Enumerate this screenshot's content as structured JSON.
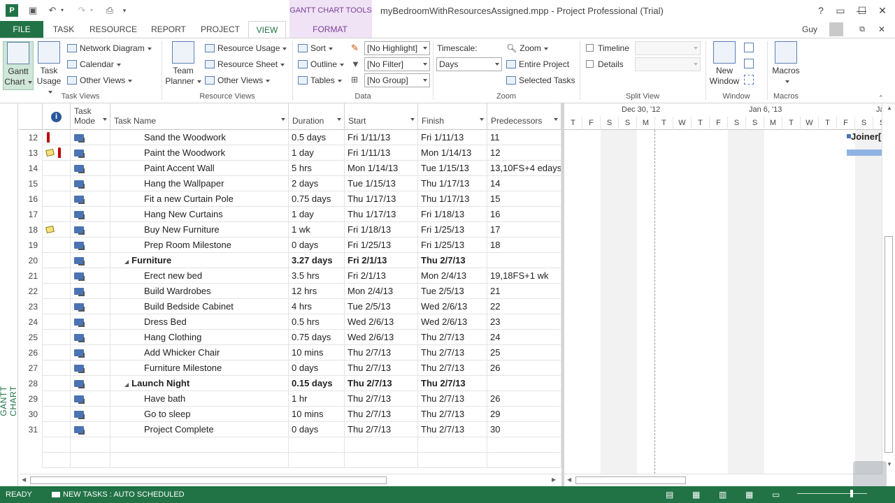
{
  "window": {
    "contextual_tab_group": "GANTT CHART TOOLS",
    "doc_title": "myBedroomWithResourcesAssigned.mpp - Project Professional (Trial)",
    "help": "?",
    "user": "Guy"
  },
  "tabs": [
    "FILE",
    "TASK",
    "RESOURCE",
    "REPORT",
    "PROJECT",
    "VIEW",
    "FORMAT"
  ],
  "ribbon": {
    "task_views": {
      "label": "Task Views",
      "gantt_chart": "Gantt Chart",
      "task_usage": "Task Usage",
      "network_diagram": "Network Diagram",
      "calendar": "Calendar",
      "other_views": "Other Views"
    },
    "resource_views": {
      "label": "Resource Views",
      "team_planner": "Team Planner",
      "resource_usage": "Resource Usage",
      "resource_sheet": "Resource Sheet",
      "other_views": "Other Views"
    },
    "data": {
      "label": "Data",
      "sort": "Sort",
      "outline": "Outline",
      "tables": "Tables",
      "highlight": "[No Highlight]",
      "filter": "[No Filter]",
      "group": "[No Group]"
    },
    "zoom": {
      "label": "Zoom",
      "timescale_label": "Timescale:",
      "timescale_value": "Days",
      "zoom": "Zoom",
      "entire_project": "Entire Project",
      "selected_tasks": "Selected Tasks"
    },
    "split_view": {
      "label": "Split View",
      "timeline": "Timeline",
      "details": "Details"
    },
    "window": {
      "label": "Window",
      "new_window": "New Window"
    },
    "macros": {
      "label": "Macros",
      "macros": "Macros"
    }
  },
  "view_side_label": "GANTT CHART",
  "columns": {
    "task_mode": "Task Mode",
    "task_name": "Task Name",
    "duration": "Duration",
    "start": "Start",
    "finish": "Finish",
    "predecessors": "Predecessors"
  },
  "rows": [
    {
      "id": "12",
      "name": "Sand the Woodwork",
      "duration": "0.5 days",
      "start": "Fri 1/11/13",
      "finish": "Fri 1/11/13",
      "pred": "11",
      "level": 2,
      "summary": false,
      "indicator": "person"
    },
    {
      "id": "13",
      "name": "Paint the Woodwork",
      "duration": "1 day",
      "start": "Fri 1/11/13",
      "finish": "Mon 1/14/13",
      "pred": "12",
      "level": 2,
      "summary": false,
      "indicator": "note-person"
    },
    {
      "id": "14",
      "name": "Paint Accent Wall",
      "duration": "5 hrs",
      "start": "Mon 1/14/13",
      "finish": "Tue 1/15/13",
      "pred": "13,10FS+4 edays",
      "level": 2,
      "summary": false,
      "indicator": ""
    },
    {
      "id": "15",
      "name": "Hang the Wallpaper",
      "duration": "2 days",
      "start": "Tue 1/15/13",
      "finish": "Thu 1/17/13",
      "pred": "14",
      "level": 2,
      "summary": false,
      "indicator": ""
    },
    {
      "id": "16",
      "name": "Fit a new Curtain Pole",
      "duration": "0.75 days",
      "start": "Thu 1/17/13",
      "finish": "Thu 1/17/13",
      "pred": "15",
      "level": 2,
      "summary": false,
      "indicator": ""
    },
    {
      "id": "17",
      "name": "Hang New Curtains",
      "duration": "1 day",
      "start": "Thu 1/17/13",
      "finish": "Fri 1/18/13",
      "pred": "16",
      "level": 2,
      "summary": false,
      "indicator": ""
    },
    {
      "id": "18",
      "name": "Buy New Furniture",
      "duration": "1 wk",
      "start": "Fri 1/18/13",
      "finish": "Fri 1/25/13",
      "pred": "17",
      "level": 2,
      "summary": false,
      "indicator": "note"
    },
    {
      "id": "19",
      "name": "Prep Room Milestone",
      "duration": "0 days",
      "start": "Fri 1/25/13",
      "finish": "Fri 1/25/13",
      "pred": "18",
      "level": 2,
      "summary": false,
      "indicator": ""
    },
    {
      "id": "20",
      "name": "Furniture",
      "duration": "3.27 days",
      "start": "Fri 2/1/13",
      "finish": "Thu 2/7/13",
      "pred": "",
      "level": 1,
      "summary": true,
      "indicator": ""
    },
    {
      "id": "21",
      "name": "Erect new bed",
      "duration": "3.5 hrs",
      "start": "Fri 2/1/13",
      "finish": "Mon 2/4/13",
      "pred": "19,18FS+1 wk",
      "level": 2,
      "summary": false,
      "indicator": ""
    },
    {
      "id": "22",
      "name": "Build Wardrobes",
      "duration": "12 hrs",
      "start": "Mon 2/4/13",
      "finish": "Tue 2/5/13",
      "pred": "21",
      "level": 2,
      "summary": false,
      "indicator": ""
    },
    {
      "id": "23",
      "name": "Build Bedside Cabinet",
      "duration": "4 hrs",
      "start": "Tue 2/5/13",
      "finish": "Wed 2/6/13",
      "pred": "22",
      "level": 2,
      "summary": false,
      "indicator": ""
    },
    {
      "id": "24",
      "name": "Dress Bed",
      "duration": "0.5 hrs",
      "start": "Wed 2/6/13",
      "finish": "Wed 2/6/13",
      "pred": "23",
      "level": 2,
      "summary": false,
      "indicator": ""
    },
    {
      "id": "25",
      "name": "Hang Clothing",
      "duration": "0.75 days",
      "start": "Wed 2/6/13",
      "finish": "Thu 2/7/13",
      "pred": "24",
      "level": 2,
      "summary": false,
      "indicator": ""
    },
    {
      "id": "26",
      "name": "Add Whicker Chair",
      "duration": "10 mins",
      "start": "Thu 2/7/13",
      "finish": "Thu 2/7/13",
      "pred": "25",
      "level": 2,
      "summary": false,
      "indicator": ""
    },
    {
      "id": "27",
      "name": "Furniture Milestone",
      "duration": "0 days",
      "start": "Thu 2/7/13",
      "finish": "Thu 2/7/13",
      "pred": "26",
      "level": 2,
      "summary": false,
      "indicator": ""
    },
    {
      "id": "28",
      "name": "Launch Night",
      "duration": "0.15 days",
      "start": "Thu 2/7/13",
      "finish": "Thu 2/7/13",
      "pred": "",
      "level": 1,
      "summary": true,
      "indicator": ""
    },
    {
      "id": "29",
      "name": "Have bath",
      "duration": "1 hr",
      "start": "Thu 2/7/13",
      "finish": "Thu 2/7/13",
      "pred": "26",
      "level": 2,
      "summary": false,
      "indicator": ""
    },
    {
      "id": "30",
      "name": "Go to sleep",
      "duration": "10 mins",
      "start": "Thu 2/7/13",
      "finish": "Thu 2/7/13",
      "pred": "29",
      "level": 2,
      "summary": false,
      "indicator": ""
    },
    {
      "id": "31",
      "name": "Project Complete",
      "duration": "0 days",
      "start": "Thu 2/7/13",
      "finish": "Thu 2/7/13",
      "pred": "30",
      "level": 2,
      "summary": false,
      "indicator": ""
    }
  ],
  "gantt": {
    "weeks": [
      "Dec 30, '12",
      "Jan 6, '13",
      "Ja"
    ],
    "days": [
      "T",
      "F",
      "S",
      "S",
      "M",
      "T",
      "W",
      "T",
      "F",
      "S",
      "S",
      "M",
      "T",
      "W",
      "T",
      "F",
      "S",
      "S"
    ],
    "bar_label": "Joiner["
  },
  "status": {
    "ready": "READY",
    "new_tasks": "NEW TASKS : AUTO SCHEDULED"
  },
  "colors": {
    "accent": "#217346",
    "contextual": "#7c3f95",
    "task_bar": "#8fb4e3"
  }
}
